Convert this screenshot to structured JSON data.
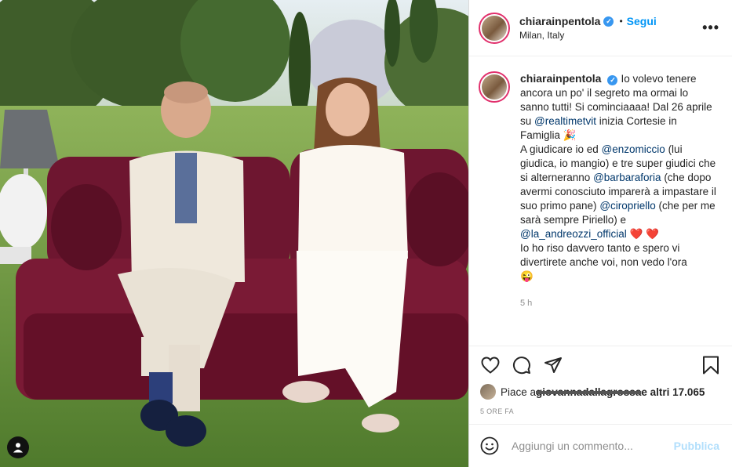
{
  "header": {
    "username": "chiarainpentola",
    "verified_icon": "verified-badge-icon",
    "separator": "•",
    "follow_label": "Segui",
    "location": "Milan, Italy",
    "more_icon": "more-options-icon",
    "more_label": "•••"
  },
  "caption": {
    "username": "chiarainpentola",
    "text_1": "Io volevo tenere ancora un po' il segreto ma ormai lo sanno tutti! Si comincia​aaa! Dal 26 aprile su ",
    "mention_1": "@realtimetvit",
    "text_2": " inizia Cortesie in Famiglia 🎉",
    "text_3": "A giudicare io ed ",
    "mention_2": "@enzomiccio",
    "text_4": " (lui giudica, io mangio) e tre super giudici che si alterneranno ",
    "mention_3": "@barbaraforia",
    "text_5": " (che dopo avermi conosciuto imparerà a impastare il suo primo pane) ",
    "mention_4": "@ciropriello",
    "text_6": " (che per me sarà sempre Piriello) e ",
    "mention_5": "@la_andreozzi_official",
    "hearts": " ❤️ ❤️",
    "text_7": "Io ho riso davvero tanto e spero vi divertirete anche voi, non vedo l'ora",
    "emoji_end": "😜",
    "time": "5 h"
  },
  "actions": {
    "like_icon": "heart-icon",
    "comment_icon": "comment-icon",
    "share_icon": "share-icon",
    "save_icon": "bookmark-icon",
    "likes_prefix": "Piace a ",
    "liker": "giovannadallagrossa",
    "likes_suffix": " e altri 17.065",
    "posted_ago": "5 ORE FA"
  },
  "comment": {
    "emoji_icon": "emoji-icon",
    "placeholder": "Aggiungi un commento...",
    "publish_label": "Pubblica"
  },
  "photo": {
    "tag_icon": "user-tag-icon"
  }
}
